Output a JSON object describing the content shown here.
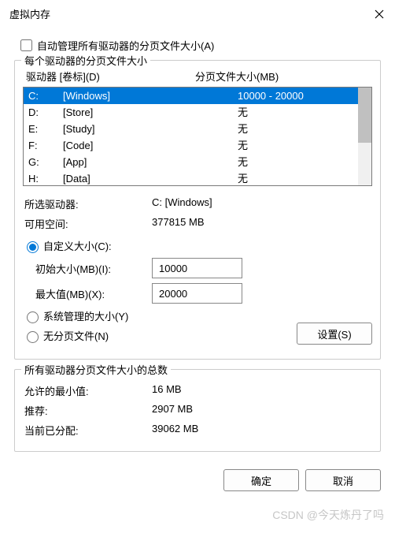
{
  "window": {
    "title": "虚拟内存"
  },
  "auto_manage": {
    "label": "自动管理所有驱动器的分页文件大小(A)",
    "checked": false
  },
  "per_drive_group_title": "每个驱动器的分页文件大小",
  "list_headers": {
    "drive": "驱动器 [卷标](D)",
    "size": "分页文件大小(MB)"
  },
  "drives": [
    {
      "letter": "C:",
      "label": "[Windows]",
      "size": "10000 - 20000",
      "selected": true
    },
    {
      "letter": "D:",
      "label": "[Store]",
      "size": "无",
      "selected": false
    },
    {
      "letter": "E:",
      "label": "[Study]",
      "size": "无",
      "selected": false
    },
    {
      "letter": "F:",
      "label": "[Code]",
      "size": "无",
      "selected": false
    },
    {
      "letter": "G:",
      "label": "[App]",
      "size": "无",
      "selected": false
    },
    {
      "letter": "H:",
      "label": "[Data]",
      "size": "无",
      "selected": false
    }
  ],
  "selected_info": {
    "drive_label": "所选驱动器:",
    "drive_value": "C:  [Windows]",
    "space_label": "可用空间:",
    "space_value": "377815 MB"
  },
  "size_options": {
    "custom_label": "自定义大小(C):",
    "initial_label": "初始大小(MB)(I):",
    "initial_value": "10000",
    "max_label": "最大值(MB)(X):",
    "max_value": "20000",
    "system_label": "系统管理的大小(Y)",
    "none_label": "无分页文件(N)",
    "selected": "custom"
  },
  "set_button": "设置(S)",
  "totals_group_title": "所有驱动器分页文件大小的总数",
  "totals": {
    "min_label": "允许的最小值:",
    "min_value": "16 MB",
    "rec_label": "推荐:",
    "rec_value": "2907 MB",
    "alloc_label": "当前已分配:",
    "alloc_value": "39062 MB"
  },
  "footer": {
    "ok": "确定",
    "cancel": "取消"
  },
  "watermark": "CSDN @今天炼丹了吗"
}
